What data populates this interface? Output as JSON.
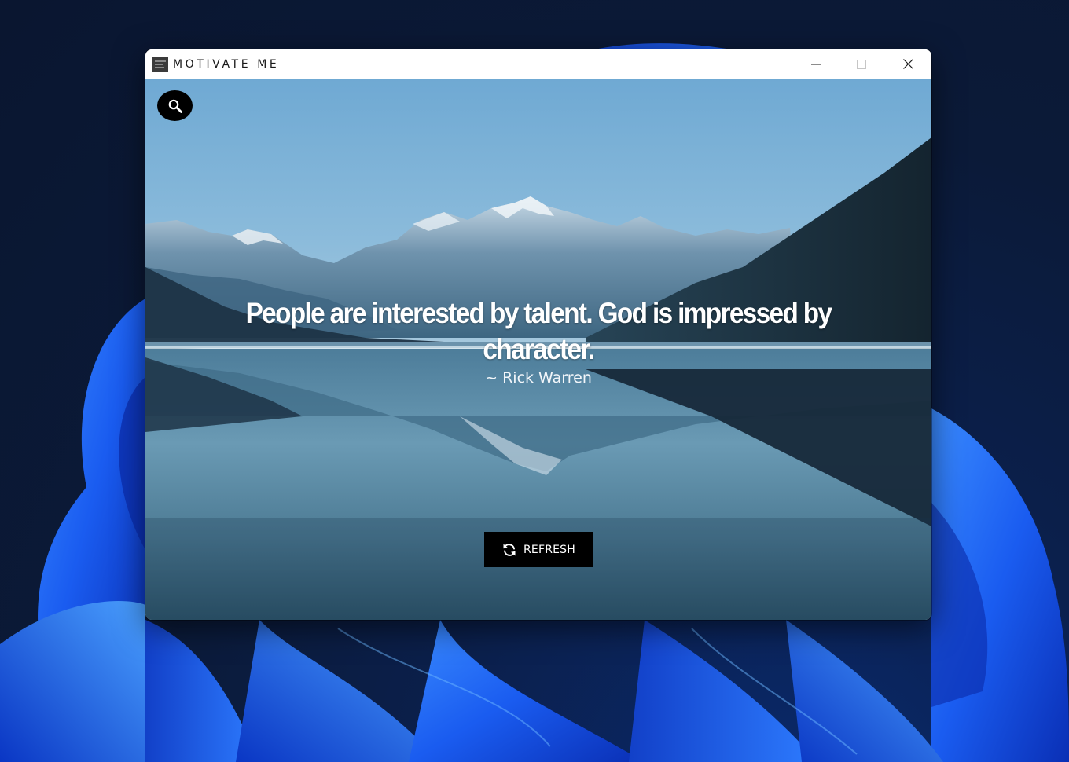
{
  "window": {
    "title": "MOTIVATE ME",
    "app_icon": "app-logo-icon",
    "controls": [
      "minimize-icon",
      "maximize-icon",
      "close-icon"
    ]
  },
  "search": {
    "icon": "search-icon"
  },
  "quote": {
    "text": "People are interested by talent. God is impressed by character.",
    "author": "~ Rick Warren"
  },
  "refresh": {
    "label": "REFRESH",
    "icon": "refresh-icon"
  },
  "colors": {
    "button_bg": "#000000",
    "text": "#ffffff",
    "titlebar_bg": "#ffffff"
  }
}
